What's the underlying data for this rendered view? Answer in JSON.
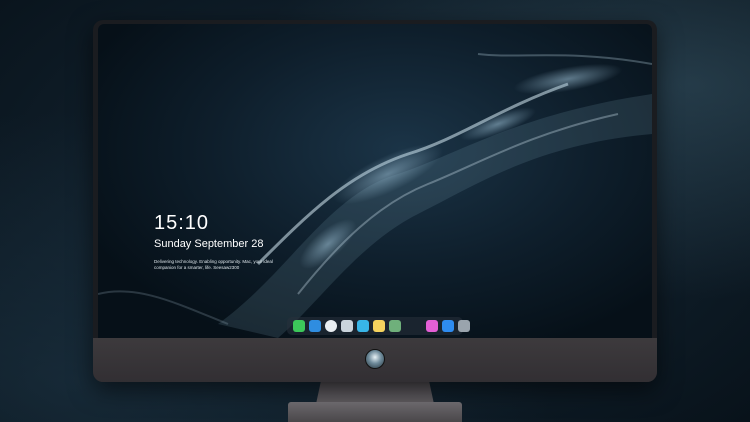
{
  "lockscreen": {
    "time": "15:10",
    "date": "Sunday September 28",
    "notice": "Delivering technology. Enabling opportunity. Mac, your ideal companion for a smarter, life. Seesaw2300"
  },
  "dock": {
    "items": [
      {
        "name": "messages-icon",
        "color": "#3cc85a"
      },
      {
        "name": "finder-icon",
        "color": "#2f8de0"
      },
      {
        "name": "safari-icon",
        "color": "#e9eef2"
      },
      {
        "name": "preview-icon",
        "color": "#c9d4dc"
      },
      {
        "name": "clips-icon",
        "color": "#38b6e8"
      },
      {
        "name": "notes-icon",
        "color": "#f4d35e"
      },
      {
        "name": "photos-icon",
        "color": "#6fb07b"
      },
      {
        "name": "itunes-icon",
        "color": "#e45fd6"
      },
      {
        "name": "app-store-icon",
        "color": "#2e8cf0"
      },
      {
        "name": "screenshot-icon",
        "color": "#9aa4ad"
      }
    ]
  },
  "colors": {
    "screen_bg": "#0e1e2b",
    "chin": "#3a373b",
    "text": "#ffffff"
  }
}
